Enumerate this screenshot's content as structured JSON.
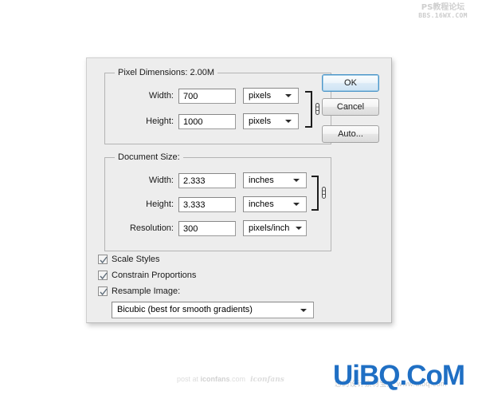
{
  "dialog": {
    "pixel_dimensions": {
      "title": "Pixel Dimensions:  2.00M",
      "width_label": "Width:",
      "width_value": "700",
      "width_unit": "pixels",
      "height_label": "Height:",
      "height_value": "1000",
      "height_unit": "pixels"
    },
    "document_size": {
      "title": "Document Size:",
      "width_label": "Width:",
      "width_value": "2.333",
      "width_unit": "inches",
      "height_label": "Height:",
      "height_value": "3.333",
      "height_unit": "inches",
      "resolution_label": "Resolution:",
      "resolution_value": "300",
      "resolution_unit": "pixels/inch"
    },
    "options": {
      "scale_styles": "Scale Styles",
      "constrain_proportions": "Constrain Proportions",
      "resample_image": "Resample Image:",
      "resample_method": "Bicubic (best for smooth gradients)"
    },
    "buttons": {
      "ok": "OK",
      "cancel": "Cancel",
      "auto": "Auto..."
    }
  },
  "watermarks": {
    "top_right_cn": "PS教程论坛",
    "top_right_url": "BBS.16WX.COM",
    "bottom_center_prefix": "post at ",
    "bottom_center_domain": "iconfans",
    "bottom_center_suffix": ".com",
    "bottom_center_logo": "iconfans",
    "bottom_right_main": "UiBQ.CoM",
    "bottom_right_sub": "您的设计素材宝库 www.uibq.com"
  },
  "colors": {
    "dialog_bg": "#ededed",
    "default_button_accent": "#4a94c8",
    "watermark_blue": "#1f6fc4"
  }
}
